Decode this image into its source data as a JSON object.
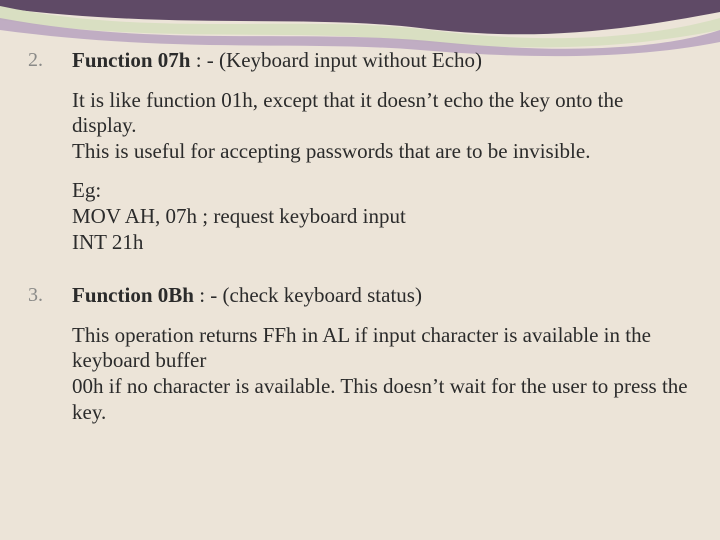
{
  "items": [
    {
      "num": "2.",
      "fn_label": "Function 07h",
      "fn_desc": " : - (Keyboard input without Echo)",
      "p1": "It is like function 01h, except that it doesn’t echo the key onto the display.",
      "p2": "This is useful for accepting passwords that are to be invisible.",
      "eg_label": "Eg:",
      "eg_l1": "MOV AH, 07h   ; request keyboard input",
      "eg_l2": "INT 21h"
    },
    {
      "num": "3.",
      "fn_label": "Function 0Bh",
      "fn_desc": " : - (check keyboard status)",
      "p1": "This operation returns FFh in AL  if input character is available in the keyboard buffer",
      "p2": "00h if no character is available. This doesn’t wait for the user to press the key."
    }
  ]
}
